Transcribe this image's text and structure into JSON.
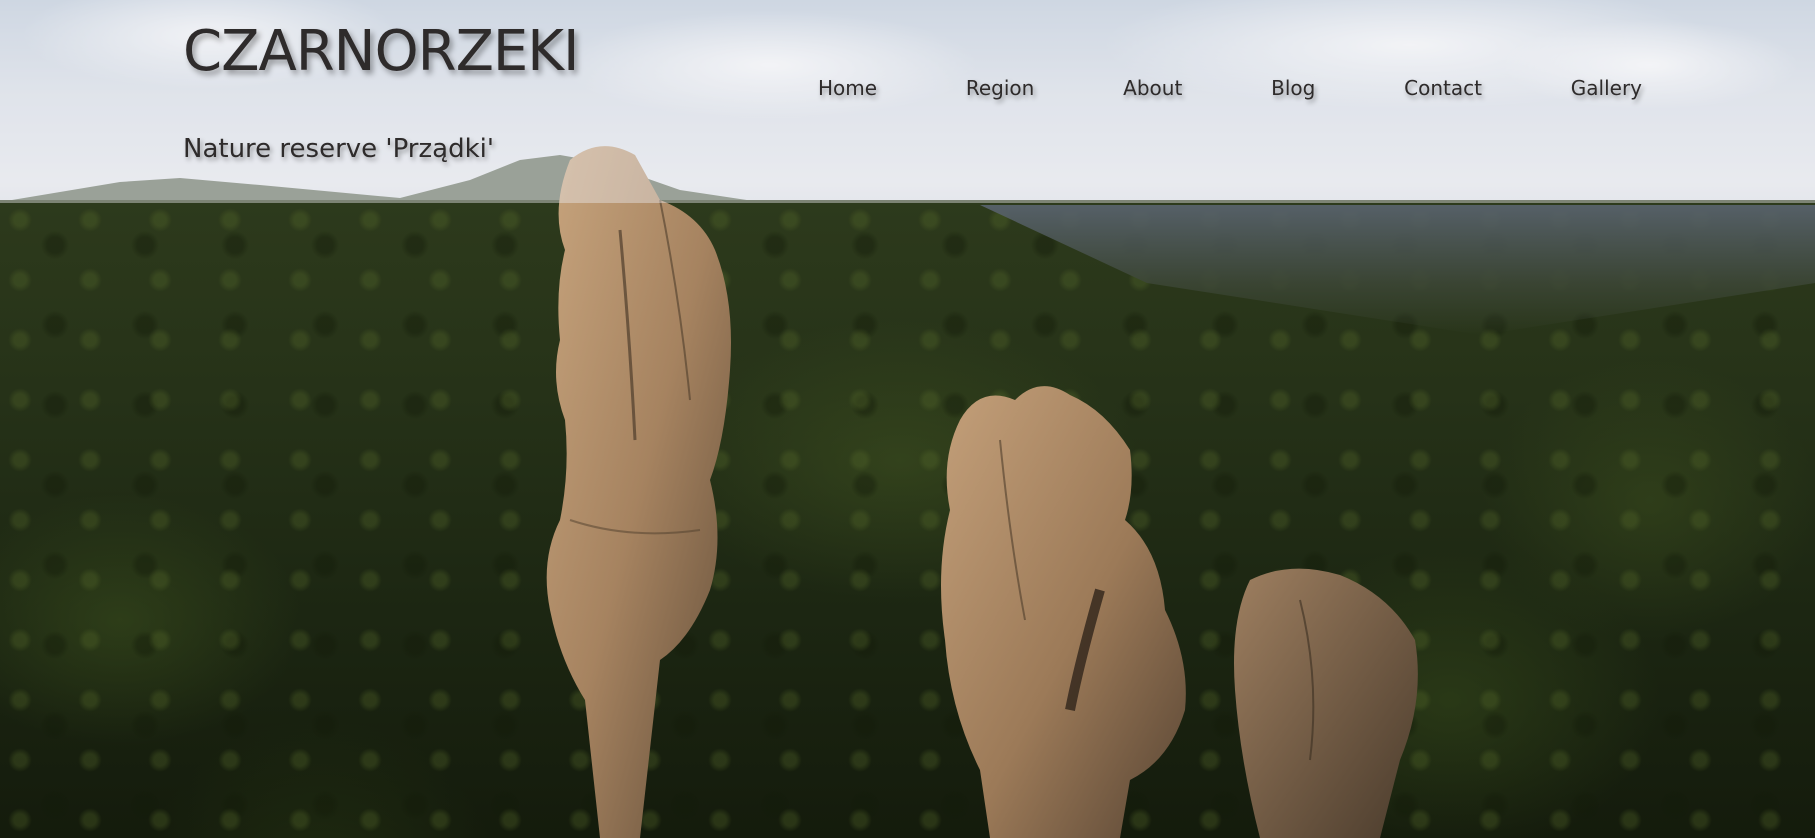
{
  "header": {
    "site_title": "CZARNORZEKI",
    "tagline": "Nature reserve 'Prządki'"
  },
  "nav": {
    "items": [
      {
        "label": "Home"
      },
      {
        "label": "Region"
      },
      {
        "label": "About"
      },
      {
        "label": "Blog"
      },
      {
        "label": "Contact"
      },
      {
        "label": "Gallery"
      }
    ]
  },
  "hero": {
    "image_subject": "aerial view of sandstone rock pillars over forest"
  },
  "colors": {
    "text": "#2e2b2b",
    "header_band": "#ebecf0",
    "forest_dark": "#1c2612",
    "rock": "#a88663"
  }
}
